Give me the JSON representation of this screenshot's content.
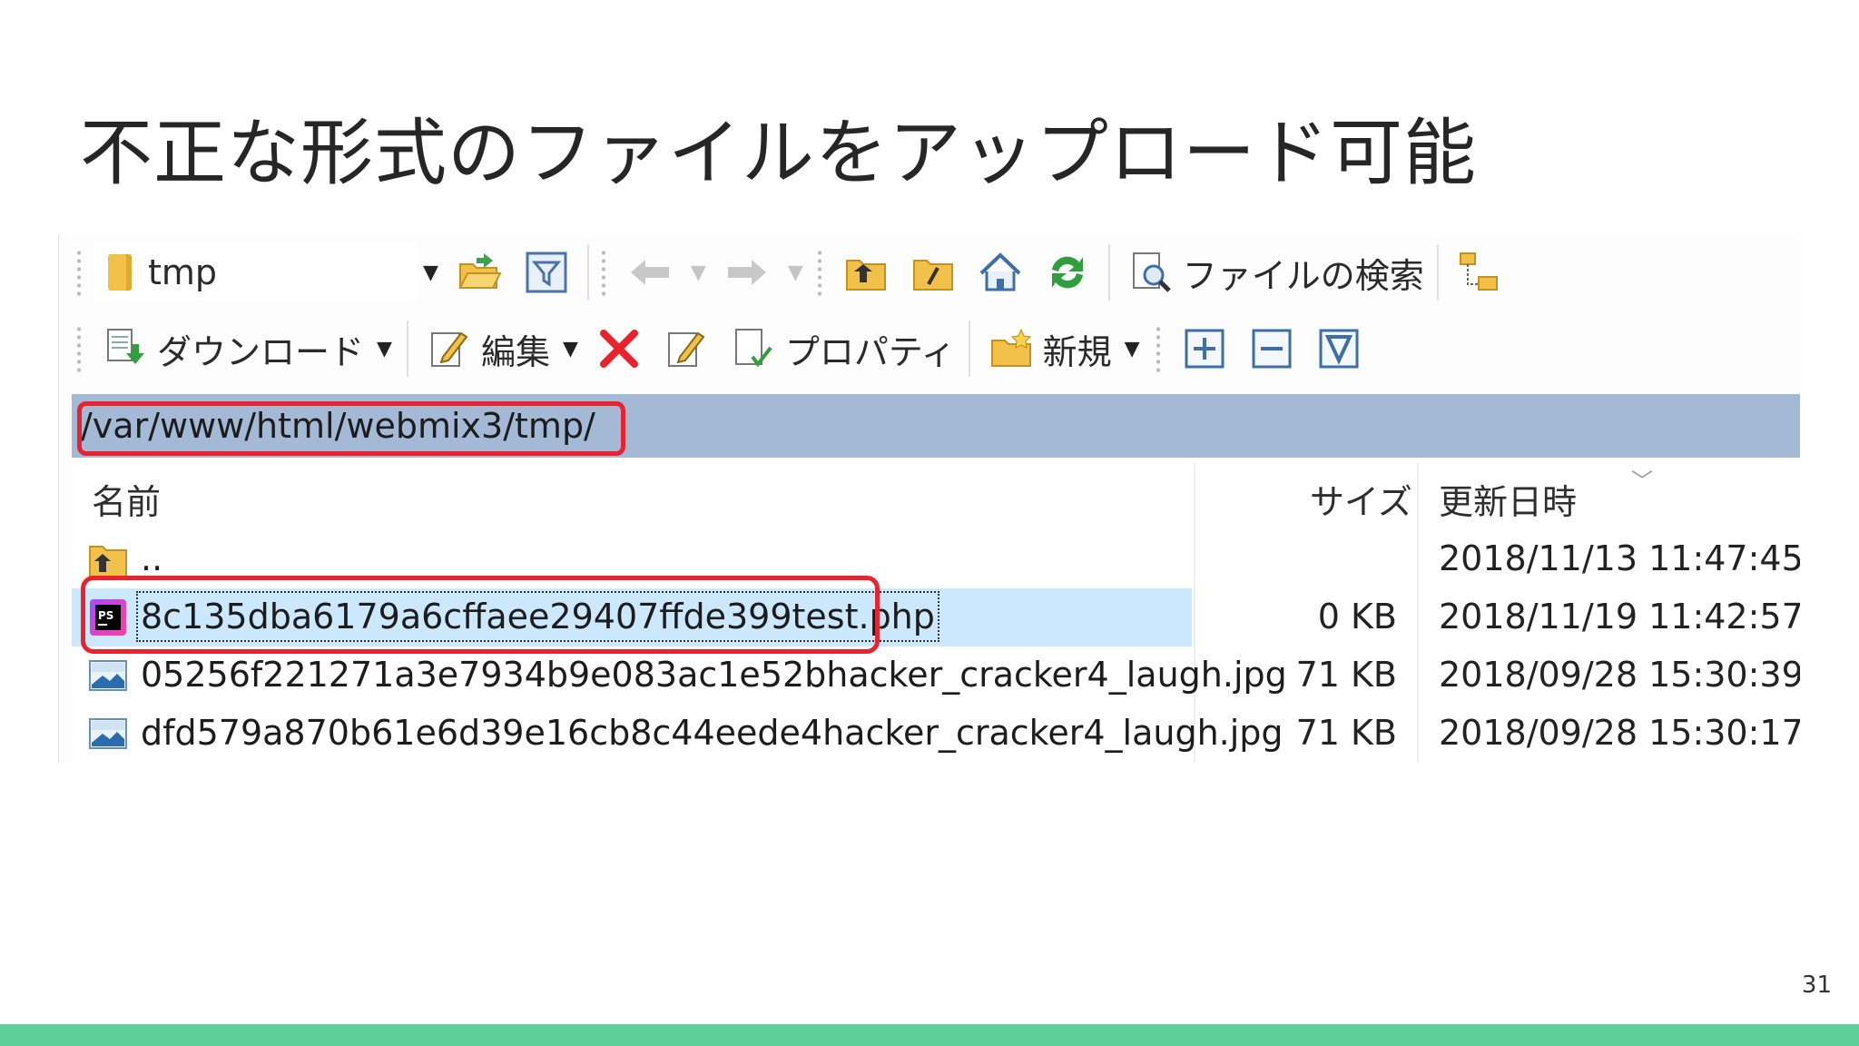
{
  "slide": {
    "title": "不正な形式のファイルをアップロード可能",
    "page_number": "31"
  },
  "toolbar1": {
    "location_value": "tmp",
    "search_label": "ファイルの検索"
  },
  "toolbar2": {
    "download_label": "ダウンロード",
    "edit_label": "編集",
    "properties_label": "プロパティ",
    "new_label": "新規"
  },
  "path": "/var/www/html/webmix3/tmp/",
  "columns": {
    "name": "名前",
    "size": "サイズ",
    "modified": "更新日時"
  },
  "files": [
    {
      "name": "..",
      "size": "",
      "modified": "2018/11/13 11:47:45",
      "icon": "parent-folder-icon"
    },
    {
      "name": "8c135dba6179a6cffaee29407ffde399test.php",
      "size": "0 KB",
      "modified": "2018/11/19 11:42:57",
      "icon": "phpstorm-file-icon"
    },
    {
      "name": "05256f221271a3e7934b9e083ac1e52bhacker_cracker4_laugh.jpg",
      "size": "71 KB",
      "modified": "2018/09/28 15:30:39",
      "icon": "image-file-icon"
    },
    {
      "name": "dfd579a870b61e6d39e16cb8c44eede4hacker_cracker4_laugh.jpg",
      "size": "71 KB",
      "modified": "2018/09/28 15:30:17",
      "icon": "image-file-icon"
    }
  ],
  "colors": {
    "accent_bar": "#5ecf98",
    "highlight_box": "#e8232d",
    "path_bar": "#a3b9d6",
    "selection": "#cce8ff"
  }
}
